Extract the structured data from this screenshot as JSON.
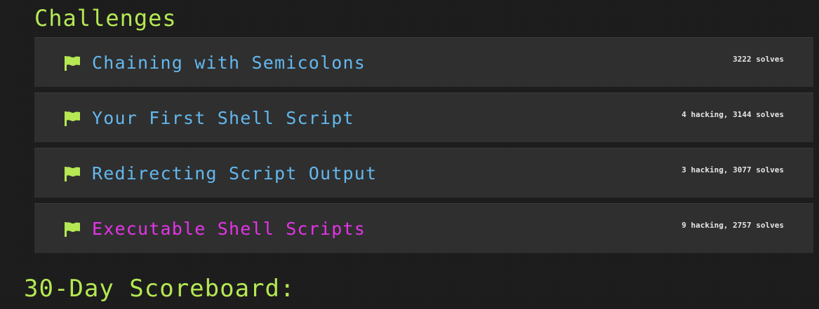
{
  "challenges_section": {
    "title": "Challenges",
    "items": [
      {
        "name": "Chaining with Semicolons",
        "stats": "3222 solves",
        "active": false
      },
      {
        "name": "Your First Shell Script",
        "stats": "4 hacking, 3144 solves",
        "active": false
      },
      {
        "name": "Redirecting Script Output",
        "stats": "3 hacking, 3077 solves",
        "active": false
      },
      {
        "name": "Executable Shell Scripts",
        "stats": "9 hacking, 2757 solves",
        "active": true
      }
    ]
  },
  "scoreboard_section": {
    "title": "30-Day Scoreboard:"
  },
  "colors": {
    "background": "#1c1c1c",
    "card": "#2f2f2f",
    "heading": "#b5e853",
    "link": "#63b8ee",
    "active_link": "#e534e8",
    "flag": "#b5e853",
    "stats_text": "#e6e6e6"
  },
  "icons": {
    "challenge_icon": "flag-icon"
  }
}
